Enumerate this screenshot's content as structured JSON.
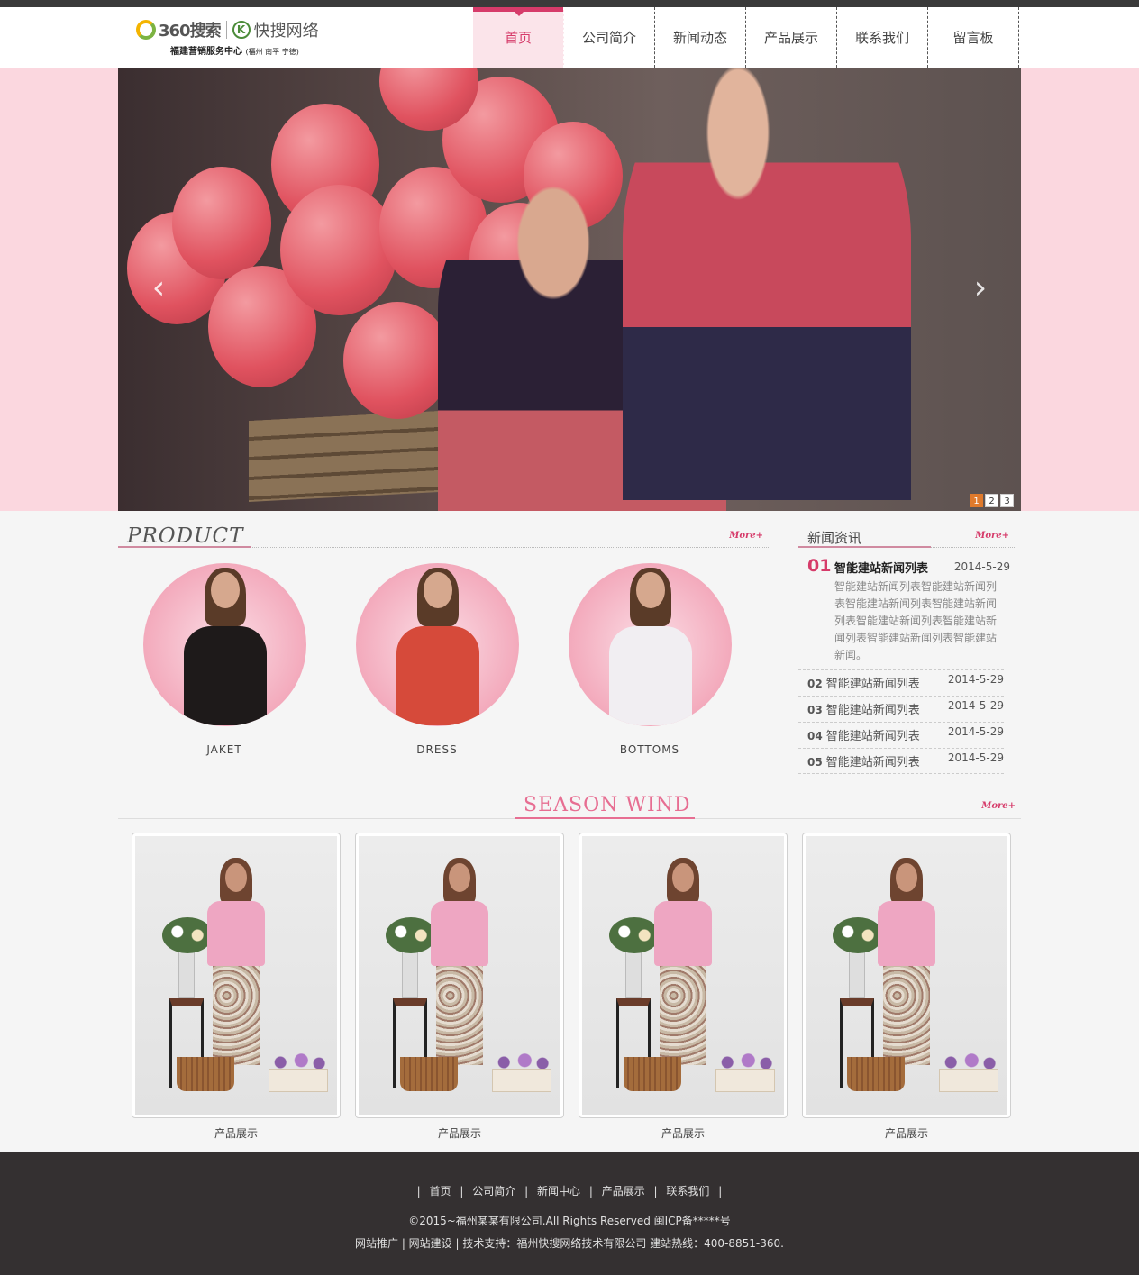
{
  "logo": {
    "brand_360": "360搜索",
    "brand_ks": "快搜网络",
    "k_icon": "K",
    "tagline": "福建营销服务中心",
    "regions": "(福州 南平 宁德)"
  },
  "nav": {
    "items": [
      {
        "label": "首页",
        "active": true
      },
      {
        "label": "公司简介"
      },
      {
        "label": "新闻动态"
      },
      {
        "label": "产品展示"
      },
      {
        "label": "联系我们"
      },
      {
        "label": "留言板"
      }
    ]
  },
  "banner": {
    "prev_icon": "chevron-left-icon",
    "next_icon": "chevron-right-icon",
    "prev_glyph": "‹",
    "next_glyph": "›",
    "pages": [
      "1",
      "2",
      "3"
    ],
    "active_page": "1"
  },
  "product": {
    "title": "PRODUCT",
    "more": "More+",
    "items": [
      {
        "label": "JAKET",
        "color": "#1e1a1a"
      },
      {
        "label": "DRESS",
        "color": "#d64a3a"
      },
      {
        "label": "BOTTOMS",
        "color": "#f1eef2"
      }
    ]
  },
  "news": {
    "title": "新闻资讯",
    "more": "More+",
    "featured": {
      "num": "01",
      "title": "智能建站新闻列表",
      "date": "2014-5-29",
      "desc": "智能建站新闻列表智能建站新闻列表智能建站新闻列表智能建站新闻列表智能建站新闻列表智能建站新闻列表智能建站新闻列表智能建站新闻。"
    },
    "items": [
      {
        "num": "02",
        "title": "智能建站新闻列表",
        "date": "2014-5-29"
      },
      {
        "num": "03",
        "title": "智能建站新闻列表",
        "date": "2014-5-29"
      },
      {
        "num": "04",
        "title": "智能建站新闻列表",
        "date": "2014-5-29"
      },
      {
        "num": "05",
        "title": "智能建站新闻列表",
        "date": "2014-5-29"
      }
    ]
  },
  "season": {
    "title": "SEASON WIND",
    "more": "More+",
    "cards": [
      {
        "label": "产品展示"
      },
      {
        "label": "产品展示"
      },
      {
        "label": "产品展示"
      },
      {
        "label": "产品展示"
      }
    ]
  },
  "footer": {
    "links": [
      "首页",
      "公司简介",
      "新闻中心",
      "产品展示",
      "联系我们"
    ],
    "copyright": "©2015~福州某某有限公司.All Rights Reserved  闽ICP备*****号",
    "support": "网站推广 | 网站建设 | 技术支持：福州快搜网络技术有限公司 建站热线：400-8851-360."
  },
  "colors": {
    "accent": "#d63b6a",
    "banner_bg": "#fbd7df",
    "footer_bg": "#343031",
    "active_dot": "#e07a2c"
  }
}
